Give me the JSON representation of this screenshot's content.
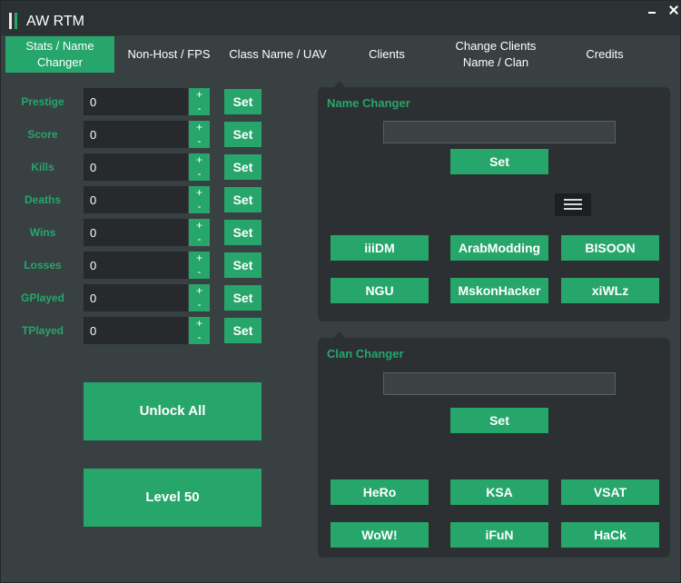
{
  "window": {
    "title": "AW RTM"
  },
  "tabs": [
    {
      "label": "Stats / Name\nChanger",
      "active": true
    },
    {
      "label": "Non-Host / FPS",
      "active": false
    },
    {
      "label": "Class Name / UAV",
      "active": false
    },
    {
      "label": "Clients",
      "active": false
    },
    {
      "label": "Change Clients\nName / Clan",
      "active": false
    },
    {
      "label": "Credits",
      "active": false
    }
  ],
  "stats": {
    "rows": [
      {
        "label": "Prestige",
        "value": "0"
      },
      {
        "label": "Score",
        "value": "0"
      },
      {
        "label": "Kills",
        "value": "0"
      },
      {
        "label": "Deaths",
        "value": "0"
      },
      {
        "label": "Wins",
        "value": "0"
      },
      {
        "label": "Losses",
        "value": "0"
      },
      {
        "label": "GPlayed",
        "value": "0"
      },
      {
        "label": "TPlayed",
        "value": "0"
      }
    ],
    "increment_label": "+",
    "decrement_label": "-",
    "set_label": "Set",
    "unlock_all_label": "Unlock All",
    "level_50_label": "Level 50"
  },
  "name_changer": {
    "title": "Name Changer",
    "input_value": "",
    "set_label": "Set",
    "presets": [
      "iiiDM",
      "ArabModding",
      "BISOON",
      "NGU",
      "MskonHacker",
      "xiWLz"
    ]
  },
  "clan_changer": {
    "title": "Clan Changer",
    "input_value": "",
    "set_label": "Set",
    "presets": [
      "HeRo",
      "KSA",
      "VSAT",
      "WoW!",
      "iFuN",
      "HaCk"
    ]
  },
  "colors": {
    "accent": "#26a66b",
    "background": "#394042",
    "panel": "#2c3032",
    "input": "#262a2c"
  }
}
